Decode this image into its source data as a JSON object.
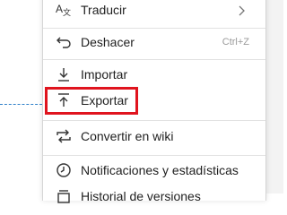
{
  "menu": {
    "items": [
      {
        "label": "Traducir",
        "icon": "translate-icon",
        "has_submenu": true
      },
      {
        "label": "Deshacer",
        "icon": "undo-icon",
        "shortcut": "Ctrl+Z"
      },
      {
        "label": "Importar",
        "icon": "import-icon"
      },
      {
        "label": "Exportar",
        "icon": "export-icon",
        "highlighted": true
      },
      {
        "label": "Convertir en wiki",
        "icon": "convert-wiki-icon"
      },
      {
        "label": "Notificaciones y estadísticas",
        "icon": "clock-icon"
      },
      {
        "label": "Historial de versiones",
        "icon": "history-icon"
      }
    ]
  },
  "colors": {
    "highlight": "#e0141e",
    "dashed_line": "#2f80c9",
    "text": "#1f1f1f",
    "shortcut": "#9a9a9a"
  }
}
